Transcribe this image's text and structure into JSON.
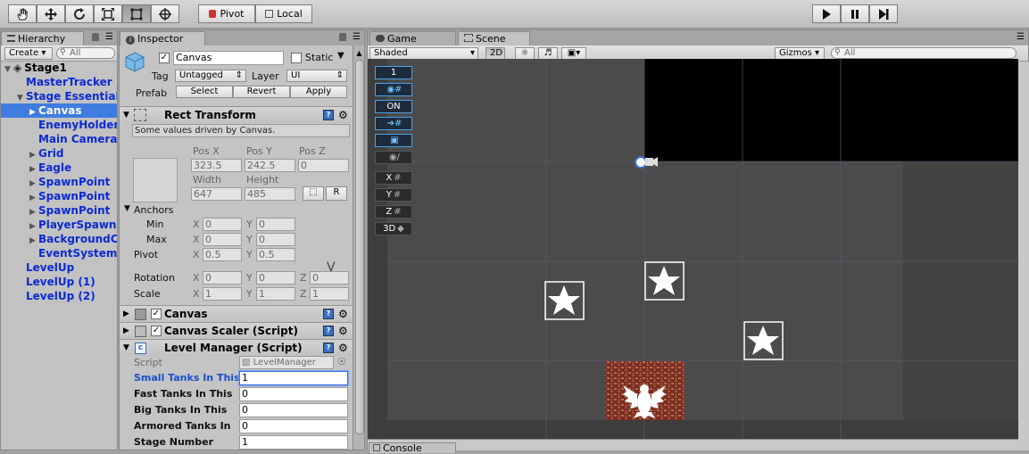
{
  "toolbar": {
    "pivot_label": "Pivot",
    "local_label": "Local",
    "tools": [
      "hand-tool",
      "move-tool",
      "rotate-tool",
      "scale-tool",
      "rect-tool",
      "transform-tool"
    ]
  },
  "hierarchy": {
    "tab_label": "Hierarchy",
    "create_label": "Create",
    "search_placeholder": "All",
    "items": [
      {
        "label": "Stage1",
        "depth": 0,
        "fold": "open"
      },
      {
        "label": "MasterTracker",
        "depth": 1,
        "fold": "none"
      },
      {
        "label": "Stage Essentials",
        "depth": 1,
        "fold": "open"
      },
      {
        "label": "Canvas",
        "depth": 2,
        "fold": "closed",
        "selected": true
      },
      {
        "label": "EnemyHolder",
        "depth": 2,
        "fold": "none"
      },
      {
        "label": "Main Camera",
        "depth": 2,
        "fold": "none"
      },
      {
        "label": "Grid",
        "depth": 2,
        "fold": "closed"
      },
      {
        "label": "Eagle",
        "depth": 2,
        "fold": "closed"
      },
      {
        "label": "SpawnPoint",
        "depth": 2,
        "fold": "closed"
      },
      {
        "label": "SpawnPoint",
        "depth": 2,
        "fold": "closed"
      },
      {
        "label": "SpawnPoint",
        "depth": 2,
        "fold": "closed"
      },
      {
        "label": "PlayerSpawnPoint",
        "depth": 2,
        "fold": "closed"
      },
      {
        "label": "BackgroundCanvas",
        "depth": 2,
        "fold": "closed"
      },
      {
        "label": "EventSystem",
        "depth": 2,
        "fold": "none"
      },
      {
        "label": "LevelUp",
        "depth": 1,
        "fold": "none"
      },
      {
        "label": "LevelUp (1)",
        "depth": 1,
        "fold": "none"
      },
      {
        "label": "LevelUp (2)",
        "depth": 1,
        "fold": "none"
      }
    ]
  },
  "inspector": {
    "tab_label": "Inspector",
    "object_name": "Canvas",
    "static_label": "Static",
    "tag_label": "Tag",
    "tag_value": "Untagged",
    "layer_label": "Layer",
    "layer_value": "UI",
    "prefab_label": "Prefab",
    "prefab_buttons": [
      "Select",
      "Revert",
      "Apply"
    ],
    "rect_transform": {
      "title": "Rect Transform",
      "info": "Some values driven by Canvas.",
      "pos_x_label": "Pos X",
      "pos_y_label": "Pos Y",
      "pos_z_label": "Pos Z",
      "pos_x": "323.5",
      "pos_y": "242.5",
      "pos_z": "0",
      "width_label": "Width",
      "height_label": "Height",
      "width": "647",
      "height": "485",
      "r_button": "R",
      "anchors_label": "Anchors",
      "min_label": "Min",
      "max_label": "Max",
      "min_x": "0",
      "min_y": "0",
      "max_x": "0",
      "max_y": "0",
      "pivot_label": "Pivot",
      "pivot_x": "0.5",
      "pivot_y": "0.5",
      "rotation_label": "Rotation",
      "rot_x": "0",
      "rot_y": "0",
      "rot_z": "0",
      "scale_label": "Scale",
      "scale_x": "1",
      "scale_y": "1",
      "scale_z": "1",
      "x": "X",
      "y": "Y",
      "z": "Z"
    },
    "components": {
      "canvas": "Canvas",
      "canvas_scaler": "Canvas Scaler (Script)",
      "level_manager": "Level Manager (Script)"
    },
    "level_manager": {
      "script_label": "Script",
      "script_value": "LevelManager",
      "fields": [
        {
          "label": "Small Tanks In This",
          "value": "1",
          "active": true
        },
        {
          "label": "Fast Tanks In This",
          "value": "0"
        },
        {
          "label": "Big Tanks In This",
          "value": "0"
        },
        {
          "label": "Armored Tanks In",
          "value": "0"
        },
        {
          "label": "Stage Number",
          "value": "1"
        }
      ]
    }
  },
  "scene": {
    "game_tab": "Game",
    "scene_tab": "Scene",
    "console_tab": "Console",
    "shading_mode": "Shaded",
    "mode_2d": "2D",
    "gizmos_label": "Gizmos",
    "search_placeholder": "All",
    "overlay_buttons": [
      "1",
      "",
      "ON",
      "",
      "",
      "",
      "X",
      "Y",
      "Z",
      "3D"
    ]
  },
  "colors": {
    "selection": "#3e7ce0",
    "hierarchy_text": "#0a2ad6",
    "scene_background": "#4a4a4a",
    "brick": "#8a3a2a"
  }
}
